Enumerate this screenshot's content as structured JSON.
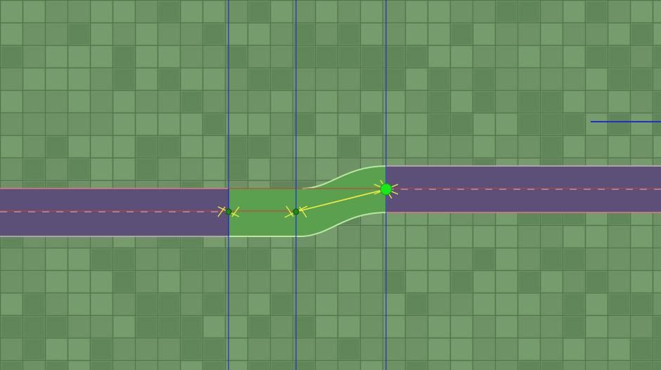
{
  "app": "road-editor-viewport",
  "colors": {
    "terrain_base": "#6b8f62",
    "terrain_tile_light": "#7a9e70",
    "terrain_tile_dark": "#5e8256",
    "terrain_grid_line": "#536f4c",
    "road_surface": "#5c4f78",
    "road_edge": "#e07a86",
    "road_center_dash": "#a6a6b8",
    "road_guide_line": "#d03a3a",
    "transition_fill": "#5aa04e",
    "transition_edge": "#b8e8a0",
    "guide_vertical": "#1f2fc8",
    "selection_line": "#f0ef3a",
    "node_small": "#1b8a1b",
    "node_selected": "#18e818"
  },
  "road": {
    "lanes": 2,
    "segments": [
      "left-straight",
      "taper-transition",
      "right-straight"
    ]
  },
  "tools": {
    "selected_node": "right-control-point",
    "snap_guides": 3
  }
}
